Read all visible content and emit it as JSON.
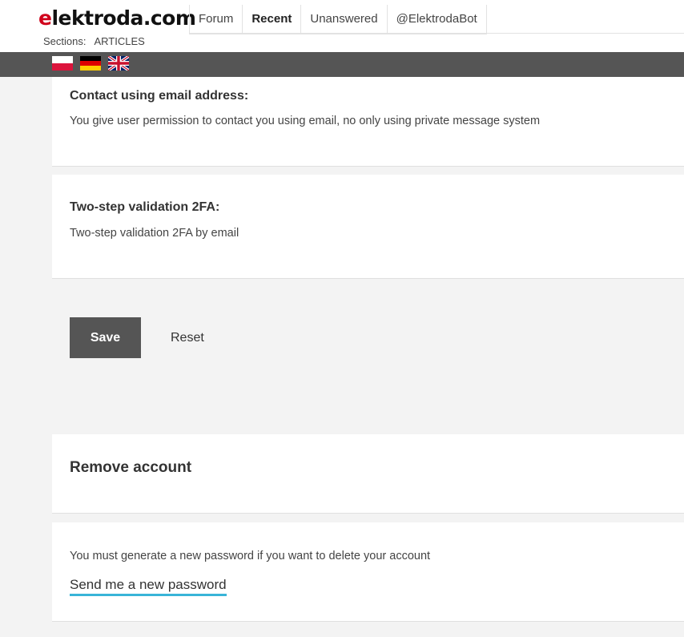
{
  "header": {
    "logo_first": "e",
    "logo_rest": "lektroda.com",
    "nav": [
      "Forum",
      "Recent",
      "Unanswered",
      "@ElektrodaBot"
    ],
    "active_nav": "Recent",
    "sections_label": "Sections:",
    "sections_value": "ARTICLES"
  },
  "languages": [
    {
      "name": "pl-flag-icon"
    },
    {
      "name": "de-flag-icon"
    },
    {
      "name": "uk-flag-icon"
    }
  ],
  "settings": {
    "email_contact": {
      "title": "Contact using email address:",
      "description": "You give user permission to contact you using email, no only using private message system"
    },
    "two_factor": {
      "title": "Two-step validation 2FA:",
      "description": "Two-step validation 2FA by email"
    }
  },
  "actions": {
    "save_label": "Save",
    "reset_label": "Reset"
  },
  "remove_account": {
    "title": "Remove account",
    "warning": "You must generate a new password if you want to delete your account",
    "link_label": "Send me a new password"
  },
  "colors": {
    "accent_link_underline": "#38b4d8",
    "logo_red": "#d0021b",
    "dark_bar": "#555555"
  }
}
